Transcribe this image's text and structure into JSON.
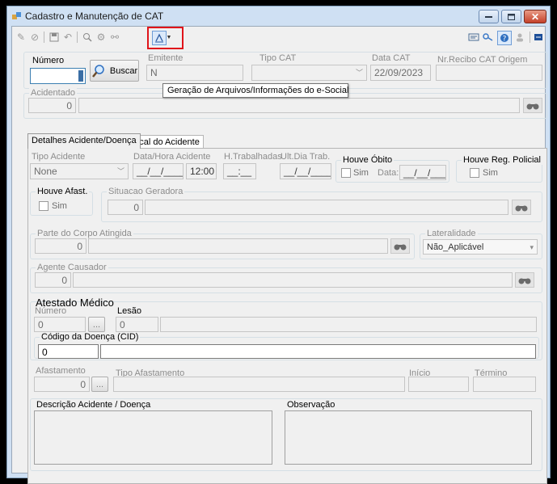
{
  "window": {
    "title": "Cadastro e Manutenção de CAT",
    "minimize": "–",
    "maximize": "□",
    "close": "✕"
  },
  "toolbar": {
    "tooltip": "Geração de Arquivos/Informações do e-Social"
  },
  "header": {
    "numero_label": "Número",
    "numero_value": "",
    "buscar_label": "Buscar",
    "emitente_label": "Emitente",
    "emitente_value": "N",
    "tipo_cat_label": "Tipo CAT",
    "data_cat_label": "Data CAT",
    "data_cat_value": "22/09/2023",
    "recibo_label": "Nr.Recibo CAT Origem",
    "recibo_value": ""
  },
  "acidentado": {
    "label": "Acidentado",
    "code": "0",
    "name": ""
  },
  "tabs": [
    {
      "label": "Detalhes Acidente/Doença"
    },
    {
      "label": "Local do Acidente"
    }
  ],
  "detalhes": {
    "tipo_acidente_label": "Tipo Acidente",
    "tipo_acidente_value": "None",
    "data_hora_label": "Data/Hora Acidente",
    "data_value": "__/__/____",
    "hora_value": "12:00",
    "h_trab_label": "H.Trabalhadas",
    "h_trab_value": "__:__",
    "ult_dia_label": "Ult.Dia Trab.",
    "ult_dia_value": "__/__/____",
    "obito_label": "Houve Óbito",
    "obito_sim": "Sim",
    "obito_data_label": "Data:",
    "obito_data_value": "__/__/____",
    "policial_label": "Houve Reg. Policial",
    "policial_sim": "Sim",
    "afast_label": "Houve Afast.",
    "afast_sim": "Sim",
    "situacao_label": "Situacao Geradora",
    "situacao_code": "0",
    "parte_label": "Parte do Corpo Atingida",
    "parte_code": "0",
    "lateralidade_label": "Lateralidade",
    "lateralidade_value": "Não_Aplicável",
    "agente_label": "Agente Causador",
    "agente_code": "0"
  },
  "atestado": {
    "title": "Atestado Médico",
    "numero_label": "Número",
    "numero_value": "0",
    "lesao_label": "Lesão",
    "lesao_code": "0",
    "cid_label": "Código da Doença (CID)",
    "cid_code": "0",
    "afastamento_label": "Afastamento",
    "afastamento_code": "0",
    "tipo_afast_label": "Tipo Afastamento",
    "inicio_label": "Início",
    "termino_label": "Término",
    "ellipsis": "..."
  },
  "bottom": {
    "descricao_label": "Descrição Acidente / Doença",
    "observacao_label": "Observação"
  }
}
